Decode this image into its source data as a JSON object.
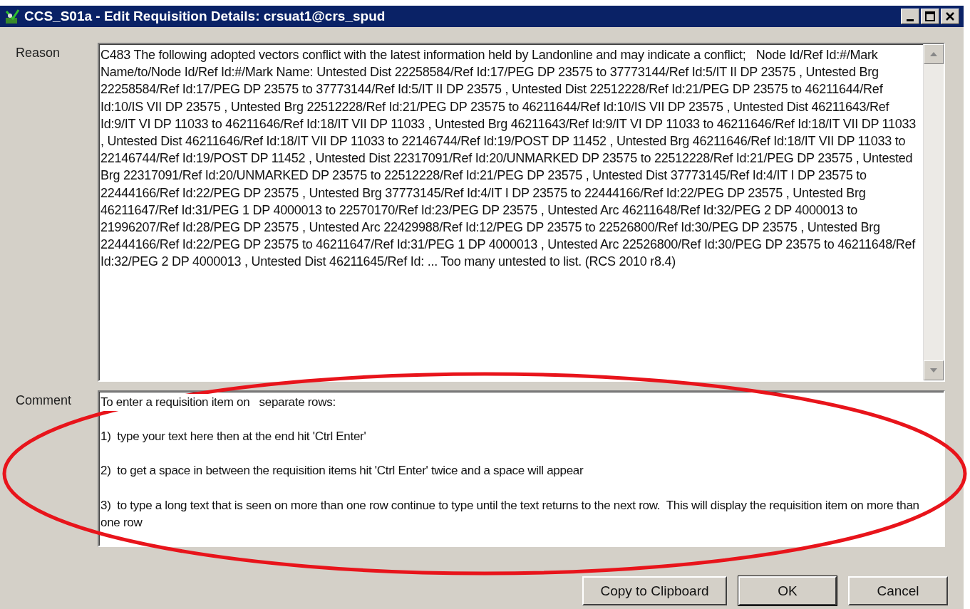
{
  "window": {
    "title": "CCS_S01a - Edit Requisition Details: crsuat1@crs_spud"
  },
  "reason": {
    "label": "Reason",
    "value": "C483 The following adopted vectors conflict with the latest information held by Landonline and may indicate a conflict;   Node Id/Ref Id:#/Mark Name/to/Node Id/Ref Id:#/Mark Name: Untested Dist 22258584/Ref Id:17/PEG DP 23575 to 37773144/Ref Id:5/IT II DP 23575 , Untested Brg 22258584/Ref Id:17/PEG DP 23575 to 37773144/Ref Id:5/IT II DP 23575 , Untested Dist 22512228/Ref Id:21/PEG DP 23575 to 46211644/Ref Id:10/IS VII DP 23575 , Untested Brg 22512228/Ref Id:21/PEG DP 23575 to 46211644/Ref Id:10/IS VII DP 23575 , Untested Dist 46211643/Ref Id:9/IT VI DP 11033 to 46211646/Ref Id:18/IT VII DP 11033 , Untested Brg 46211643/Ref Id:9/IT VI DP 11033 to 46211646/Ref Id:18/IT VII DP 11033 , Untested Dist 46211646/Ref Id:18/IT VII DP 11033 to 22146744/Ref Id:19/POST DP 11452 , Untested Brg 46211646/Ref Id:18/IT VII DP 11033 to 22146744/Ref Id:19/POST DP 11452 , Untested Dist 22317091/Ref Id:20/UNMARKED DP 23575 to 22512228/Ref Id:21/PEG DP 23575 , Untested Brg 22317091/Ref Id:20/UNMARKED DP 23575 to 22512228/Ref Id:21/PEG DP 23575 , Untested Dist 37773145/Ref Id:4/IT I DP 23575 to 22444166/Ref Id:22/PEG DP 23575 , Untested Brg 37773145/Ref Id:4/IT I DP 23575 to 22444166/Ref Id:22/PEG DP 23575 , Untested Brg 46211647/Ref Id:31/PEG 1 DP 4000013 to 22570170/Ref Id:23/PEG DP 23575 , Untested Arc 46211648/Ref Id:32/PEG 2 DP 4000013 to 21996207/Ref Id:28/PEG DP 23575 , Untested Arc 22429988/Ref Id:12/PEG DP 23575 to 22526800/Ref Id:30/PEG DP 23575 , Untested Brg 22444166/Ref Id:22/PEG DP 23575 to 46211647/Ref Id:31/PEG 1 DP 4000013 , Untested Arc 22526800/Ref Id:30/PEG DP 23575 to 46211648/Ref Id:32/PEG 2 DP 4000013 , Untested Dist 46211645/Ref Id: ... Too many untested to list. (RCS 2010 r8.4)"
  },
  "comment": {
    "label": "Comment",
    "lines": [
      "To enter a requisition item on   separate rows:",
      "1)  type your text here then at the end hit 'Ctrl Enter'",
      "2)  to get a space in between the requisition items hit 'Ctrl Enter' twice and a space will appear",
      "3)  to type a long text that is seen on more than one row continue to type until the text returns to the next row.  This will display the requisition item on more than one row"
    ]
  },
  "buttons": [
    {
      "label": "Copy to Clipboard",
      "default": false
    },
    {
      "label": "OK",
      "default": true
    },
    {
      "label": "Cancel",
      "default": false
    }
  ]
}
